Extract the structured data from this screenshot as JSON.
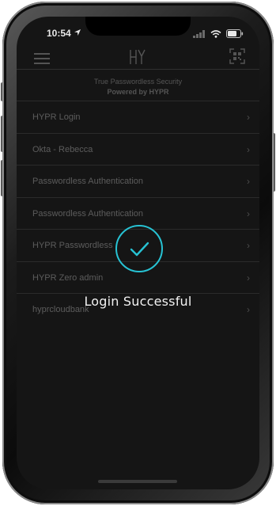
{
  "status_bar": {
    "time": "10:54",
    "icons": [
      "location-arrow-icon",
      "signal-bars-icon",
      "wifi-icon",
      "battery-icon"
    ]
  },
  "header": {
    "logo": "HYPR",
    "menu_icon": "hamburger-menu-icon",
    "scan_icon": "qr-scan-icon"
  },
  "tagline": {
    "line1": "True Passwordless Security",
    "line2": "Powered by HYPR"
  },
  "accounts": [
    {
      "label": "HYPR Login"
    },
    {
      "label": "Okta - Rebecca"
    },
    {
      "label": "Passwordless Authentication"
    },
    {
      "label": "Passwordless Authentication"
    },
    {
      "label": "HYPR Passwordless"
    },
    {
      "label": "HYPR Zero admin"
    },
    {
      "label": "hyprcloudbank"
    }
  ],
  "overlay": {
    "message": "Login Successful",
    "icon": "checkmark-circle-icon"
  },
  "colors": {
    "accent": "#27c2d3",
    "screen_bg": "#151515",
    "text": "#f2f2f2"
  }
}
